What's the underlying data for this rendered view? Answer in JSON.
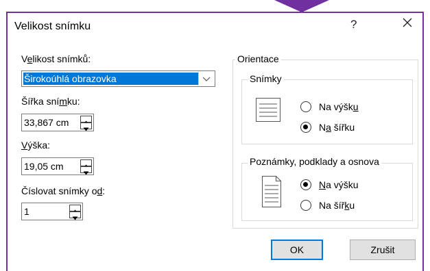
{
  "dialog": {
    "title": "Velikost snímku",
    "help": "?",
    "close_icon": "close-icon"
  },
  "slide_size": {
    "label_pre": "V",
    "label_ul": "e",
    "label_post": "likost snímků:",
    "value": "Širokoúhlá obrazovka"
  },
  "width": {
    "label_pre": "Šířka sní",
    "label_ul": "m",
    "label_post": "ku:",
    "value": "33,867 cm"
  },
  "height": {
    "label_ul": "V",
    "label_post": "ýška:",
    "value": "19,05 cm"
  },
  "numbering": {
    "label_pre": "Číslovat snímky o",
    "label_ul": "d",
    "label_post": ":",
    "value": "1"
  },
  "orientation": {
    "title": "Orientace",
    "slides": {
      "title": "Snímky",
      "portrait_pre": "Na výšk",
      "portrait_ul": "u",
      "landscape_pre": "N",
      "landscape_ul": "a",
      "landscape_post": " šířku",
      "selected": "landscape"
    },
    "notes": {
      "title": "Poznámky, podklady a osnova",
      "portrait_ul": "N",
      "portrait_post": "a výšku",
      "landscape_pre": "Na šíř",
      "landscape_ul": "k",
      "landscape_post": "u",
      "selected": "portrait"
    }
  },
  "buttons": {
    "ok": "OK",
    "cancel": "Zrušit"
  },
  "colors": {
    "accent": "#0078d7",
    "frame": "#7030a0"
  }
}
